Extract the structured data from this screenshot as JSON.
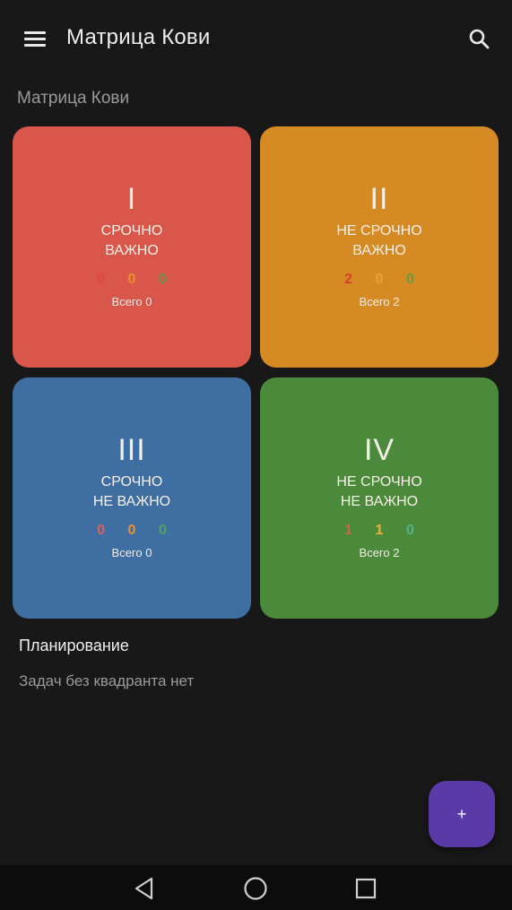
{
  "appbar": {
    "title": "Матрица Кови",
    "menu_icon": "menu-icon",
    "search_icon": "search-icon"
  },
  "section": {
    "title": "Матрица Кови"
  },
  "quadrants": [
    {
      "numeral": "I",
      "line1": "СРОЧНО",
      "line2": "ВАЖНО",
      "color": "#d9574a",
      "counts": [
        "0",
        "0",
        "0"
      ],
      "count_colors": [
        "#e0463b",
        "#e8902a",
        "#5a9a48"
      ],
      "total": "Всего 0"
    },
    {
      "numeral": "II",
      "line1": "НЕ СРОЧНО",
      "line2": "ВАЖНО",
      "color": "#d68a24",
      "counts": [
        "2",
        "0",
        "0"
      ],
      "count_colors": [
        "#d8402c",
        "#eaa23a",
        "#5e9e44"
      ],
      "total": "Всего 2"
    },
    {
      "numeral": "III",
      "line1": "СРОЧНО",
      "line2": "НЕ ВАЖНО",
      "color": "#3f6ea2",
      "counts": [
        "0",
        "0",
        "0"
      ],
      "count_colors": [
        "#d86258",
        "#e8922c",
        "#52a25a"
      ],
      "total": "Всего 0"
    },
    {
      "numeral": "IV",
      "line1": "НЕ СРОЧНО",
      "line2": "НЕ ВАЖНО",
      "color": "#4a8a3a",
      "counts": [
        "1",
        "1",
        "0"
      ],
      "count_colors": [
        "#c8664a",
        "#e6b040",
        "#58b48a"
      ],
      "total": "Всего 2"
    }
  ],
  "planning": {
    "title": "Планирование",
    "empty_text": "Задач без квадранта нет"
  },
  "fab": {
    "label": "+",
    "color": "#5a3aa6"
  },
  "navbar": {
    "icons": [
      "back-icon",
      "home-icon",
      "recent-apps-icon"
    ]
  }
}
